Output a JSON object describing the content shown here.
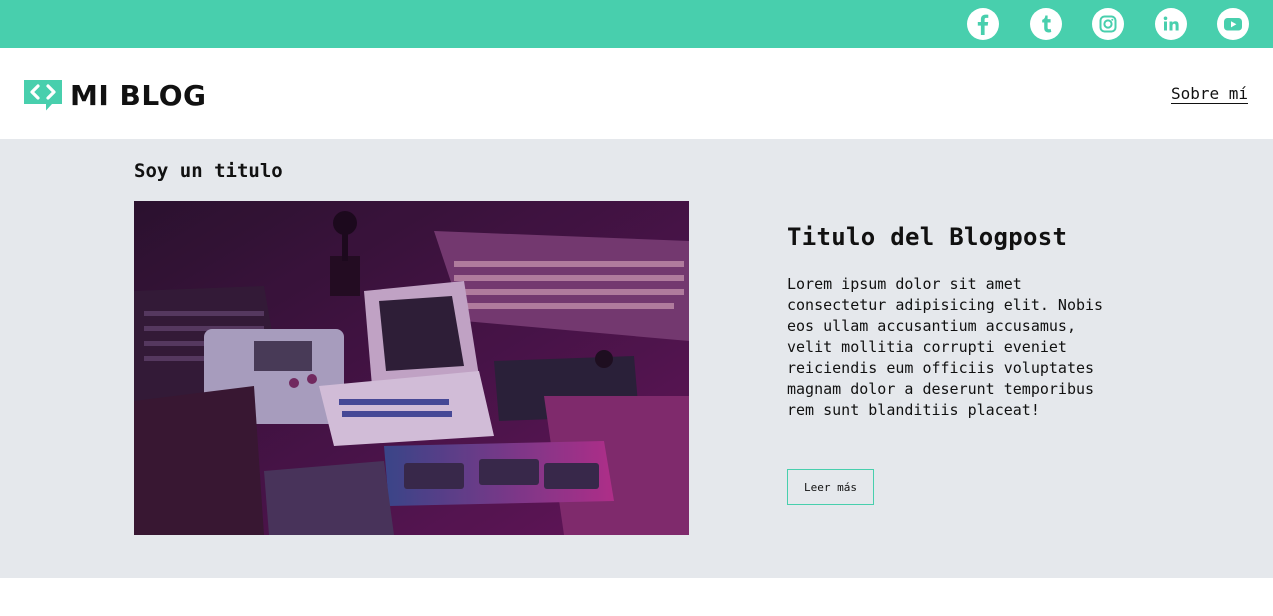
{
  "colors": {
    "accent": "#48cfad",
    "background_section": "#e5e8ec",
    "text": "#111111"
  },
  "social": [
    {
      "name": "facebook-icon"
    },
    {
      "name": "tumblr-icon"
    },
    {
      "name": "instagram-icon"
    },
    {
      "name": "linkedin-icon"
    },
    {
      "name": "youtube-icon"
    }
  ],
  "header": {
    "logo_text": "MI BLOG",
    "nav": {
      "about_label": "Sobre mí"
    }
  },
  "main": {
    "section_title": "Soy un titulo",
    "post": {
      "image_icon": "retro-computers-photo",
      "title": "Titulo del Blogpost",
      "body": "Lorem ipsum dolor sit amet consectetur adipisicing elit. Nobis eos ullam accusantium accusamus, velit mollitia corrupti eveniet reiciendis eum officiis voluptates magnam dolor a deserunt temporibus rem sunt blanditiis placeat!",
      "button_label": "Leer más"
    }
  }
}
